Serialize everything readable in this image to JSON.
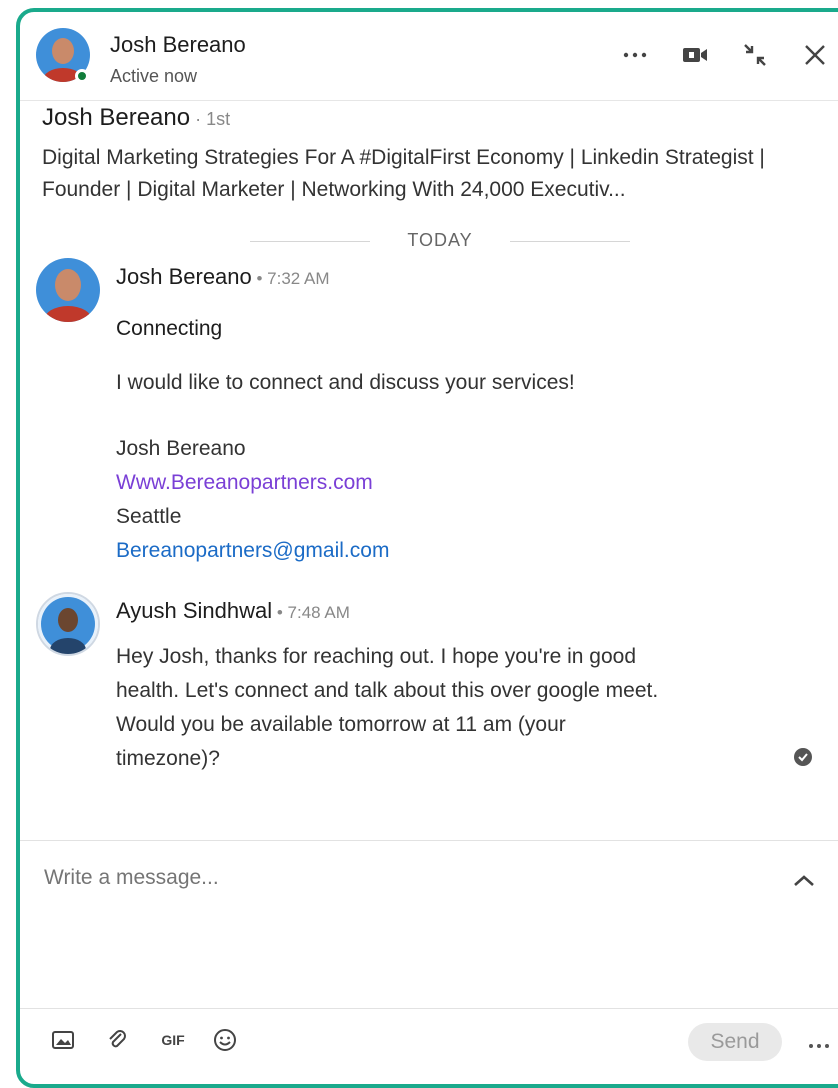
{
  "header": {
    "name": "Josh Bereano",
    "status": "Active now"
  },
  "profile": {
    "name": "Josh Bereano",
    "degree": " · 1st",
    "headline": "Digital Marketing Strategies For A #DigitalFirst Economy | Linkedin Strategist | Founder | Digital Marketer | Networking With 24,000 Executiv..."
  },
  "divider": {
    "label": "TODAY"
  },
  "messages": [
    {
      "sender": "Josh Bereano",
      "time": " • 7:32 AM",
      "subject": "Connecting",
      "body": "I would like to connect and discuss your services!",
      "sig_name": "Josh Bereano",
      "sig_url": "Www.Bereanopartners.com",
      "sig_city": "Seattle",
      "sig_email": "Bereanopartners@gmail.com"
    },
    {
      "sender": "Ayush Sindhwal",
      "time": " • 7:48 AM",
      "body_lines": [
        "Hey Josh, thanks for reaching out. I hope you're in good",
        "health. Let's connect and talk about this over google meet.",
        "Would you be available tomorrow at 11 am (your",
        "timezone)?"
      ]
    }
  ],
  "compose": {
    "placeholder": "Write a message...",
    "send_label": "Send",
    "gif_label": "GIF"
  },
  "colors": {
    "window_border": "#1aaa8c",
    "online": "#117d3a",
    "link_url": "#7a3fd6",
    "link_email": "#1b6bc6"
  }
}
